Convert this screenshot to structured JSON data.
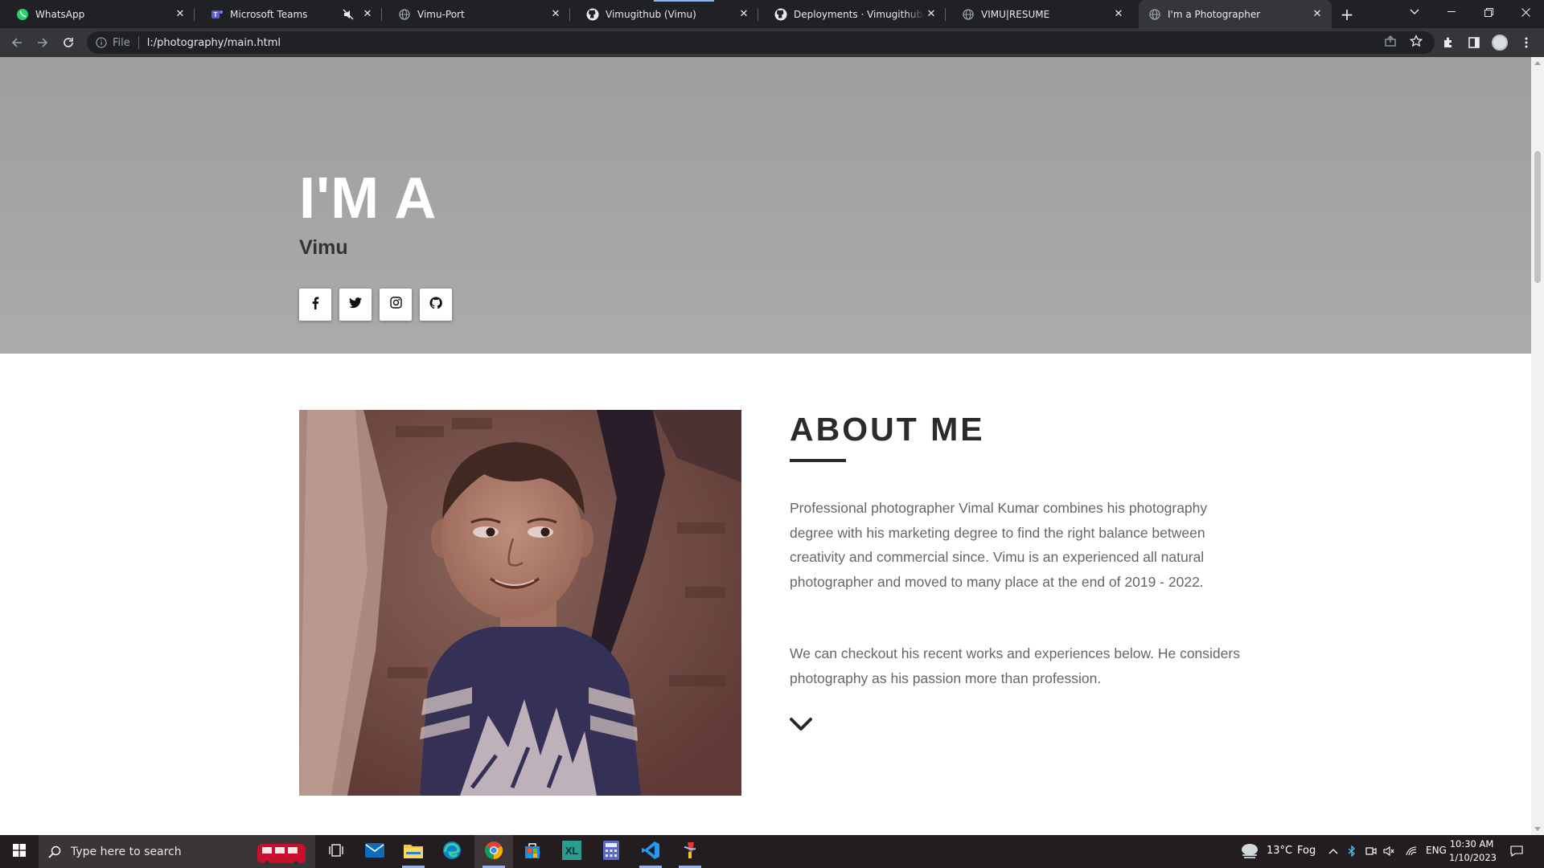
{
  "tabs": [
    {
      "title": "WhatsApp",
      "icon": "whatsapp-icon"
    },
    {
      "title": "Microsoft Teams",
      "icon": "teams-icon"
    },
    {
      "title": "Vimu-Port",
      "icon": "globe-icon"
    },
    {
      "title": "Vimugithub (Vimu)",
      "icon": "github-icon"
    },
    {
      "title": "Deployments · Vimugithub/V-re",
      "icon": "github-icon"
    },
    {
      "title": "VIMU|RESUME",
      "icon": "globe-icon"
    },
    {
      "title": "I'm a Photographer",
      "icon": "globe-icon"
    }
  ],
  "address_bar": {
    "scheme_label": "File",
    "url": "l:/photography/main.html"
  },
  "hero": {
    "title": "I'M A",
    "name": "Vimu",
    "social": [
      "facebook-icon",
      "twitter-icon",
      "instagram-icon",
      "github-icon"
    ]
  },
  "about": {
    "title": "ABOUT ME",
    "p1": "Professional photographer Vimal Kumar combines his photography degree with his marketing degree to find the right balance between creativity and commercial since. Vimu is an experienced all natural photographer and moved to many place at the end of 2019 - 2022.",
    "p2": "We can checkout his recent works and experiences below. He considers photography as his passion more than profession."
  },
  "taskbar": {
    "search_placeholder": "Type here to search",
    "weather_temp": "13°C",
    "weather_cond": "Fog",
    "language": "ENG",
    "time": "10:30 AM",
    "date": "1/10/2023"
  },
  "colors": {
    "accent": "#8ab4f8",
    "hero_bg": "#a6a6a6",
    "heading": "#2b2b2b"
  }
}
